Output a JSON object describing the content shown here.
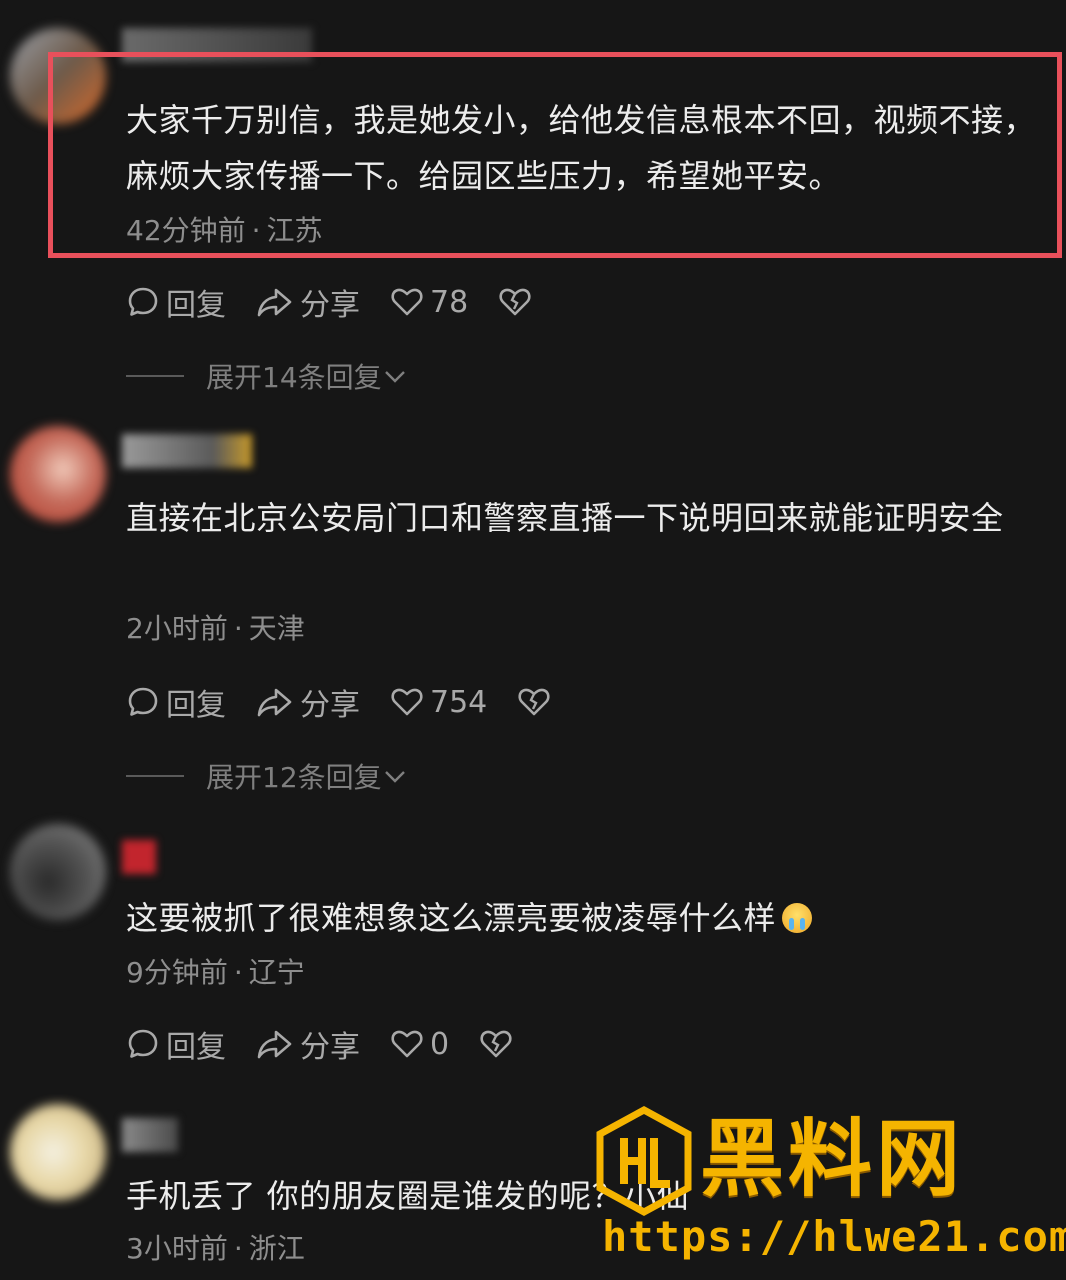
{
  "labels": {
    "reply": "回复",
    "share": "分享",
    "sep": "·"
  },
  "comments": [
    {
      "text": "大家千万别信，我是她发小，给他发信息根本不回，视频不接，麻烦大家传播一下。给园区些压力，希望她平安。",
      "time": "42分钟前",
      "location": "江苏",
      "likes": "78",
      "expand": "展开14条回复"
    },
    {
      "text": "直接在北京公安局门口和警察直播一下说明回来就能证明安全",
      "time": "2小时前",
      "location": "天津",
      "likes": "754",
      "expand": "展开12条回复"
    },
    {
      "text": "这要被抓了很难想象这么漂亮要被凌辱什么样",
      "emoji": "crying-face",
      "time": "9分钟前",
      "location": "辽宁",
      "likes": "0"
    },
    {
      "text": "手机丢了 你的朋友圈是谁发的呢？小仙",
      "time": "3小时前",
      "location": "浙江"
    }
  ],
  "watermark": {
    "title": "黑料网",
    "url": "https://hlwe21.com"
  },
  "colors": {
    "background": "#161616",
    "highlight": "#e8505b",
    "meta": "#8e8e8e",
    "watermark": "#f5b400"
  }
}
